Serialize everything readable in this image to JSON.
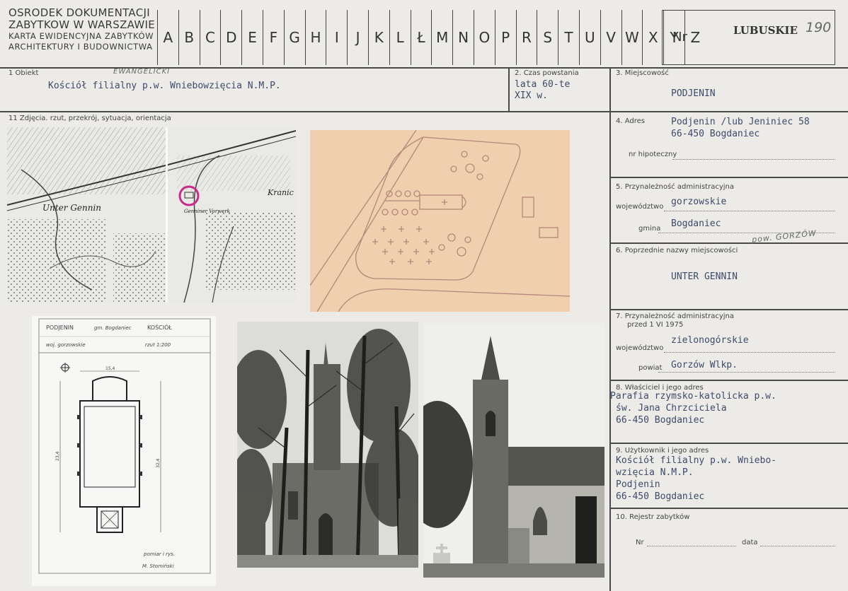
{
  "header": {
    "org_line1": "OSRODEK DOKUMENTACJI",
    "org_line2": "ZABYTKOW W WARSZAWIE",
    "org_line3": "KARTA EWIDENCYJNA ZABYTKÓW",
    "org_line4": "ARCHITEKTURY I BUDOWNICTWA",
    "letters": [
      "A",
      "B",
      "C",
      "D",
      "E",
      "F",
      "G",
      "H",
      "I",
      "J",
      "K",
      "L",
      "Ł",
      "M",
      "N",
      "O",
      "P",
      "R",
      "S",
      "T",
      "U",
      "V",
      "W",
      "X",
      "Y",
      "Z"
    ],
    "nr_label": "Nr",
    "region": "LUBUSKIE",
    "region_number": "190"
  },
  "fields": {
    "obiekt_label": "1 Obiekt",
    "obiekt_handnote": "EWANGELICKI",
    "obiekt_value": "Kościół filialny p.w. Wniebowzięcia N.M.P.",
    "czas_label": "2. Czas powstania",
    "czas_value_1": "lata 60-te",
    "czas_value_2": "XIX w.",
    "miejscowosc_label": "3. Miejscowość",
    "miejscowosc_value": "PODJENIN",
    "zdjecia_label": "11 Zdjęcia. rzut, przekrój, sytuacja, orientacja",
    "adres_label": "4. Adres",
    "adres_value_1": "Podjenin /lub Jeniniec 58",
    "adres_value_2": "66-450 Bogdaniec",
    "hipoteczny_label": "nr hipoteczny",
    "przynal_label": "5. Przynależność administracyjna",
    "wojewodztwo_label": "województwo",
    "wojewodztwo_value": "gorzowskie",
    "gmina_label": "gmina",
    "gmina_value": "Bogdaniec",
    "gmina_handnote": "pow. GORZÓW",
    "poprzednie_label": "6. Poprzednie nazwy miejscowości",
    "poprzednie_value": "UNTER GENNIN",
    "przynal75_label_1": "7. Przynależność administracyjna",
    "przynal75_label_2": "przed 1 VI 1975",
    "woj75_label": "województwo",
    "woj75_value": "zielonogórskie",
    "powiat_label": "powiat",
    "powiat_value": "Gorzów Wlkp.",
    "wlasciciel_label": "8. Właściciel i jego adres",
    "wlasciciel_value_1": "Parafia rzymsko-katolicka p.w.",
    "wlasciciel_value_2": "św. Jana Chrzciciela",
    "wlasciciel_value_3": "66-450 Bogdaniec",
    "uzytkownik_label": "9. Użytkownik i jego adres",
    "uzytkownik_value_1": "Kościół filialny p.w. Wniebo-",
    "uzytkownik_value_2": "wzięcia N.M.P.",
    "uzytkownik_value_3": "Podjenin",
    "uzytkownik_value_4": "66-450 Bogdaniec",
    "rejestr_label": "10. Rejestr zabytków",
    "nr_label": "Nr",
    "data_label": "data"
  },
  "map": {
    "label_unter": "Unter Gennin",
    "label_kran": "Kranic",
    "label_vorw": "Genniner Vorwerk"
  },
  "plan": {
    "place": "PODJENIN",
    "gmina": "gm. Bogdaniec",
    "object": "KOŚCIÓŁ",
    "woj": "woj. gorzowskie",
    "scale": "rzut 1:200",
    "dim_top": "15,4",
    "dim_side": "32,4",
    "dim_inner": "23,4",
    "author_1": "pomiar i rys.",
    "author_2": "M. Stomiński"
  },
  "colors": {
    "card": "#ecebe7",
    "line": "#4a4a4a",
    "type": "#3d4a6a",
    "sketch_paper": "#efcfae",
    "sketch_ink": "#b5877a",
    "stamp": "#cc2a8a"
  }
}
